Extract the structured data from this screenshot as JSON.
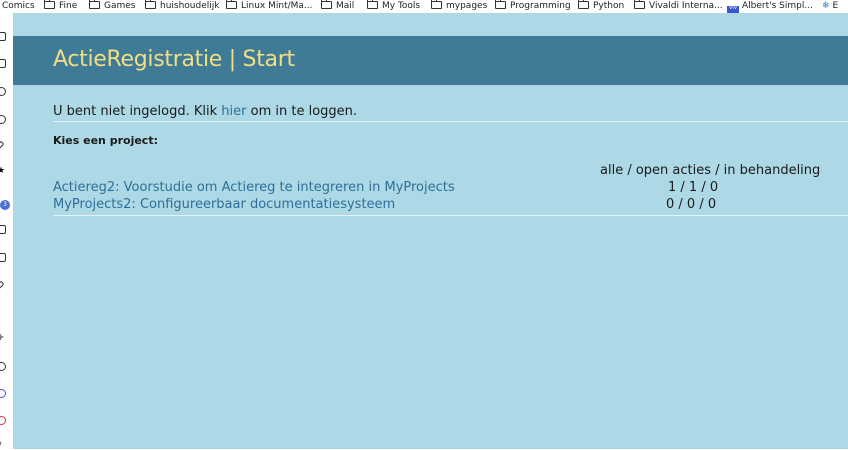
{
  "bookmarks": [
    {
      "label": "Comics",
      "icon": "none"
    },
    {
      "label": "Fine",
      "icon": "folder-icon"
    },
    {
      "label": "Games",
      "icon": "folder-icon"
    },
    {
      "label": "huishoudelijk",
      "icon": "folder-icon"
    },
    {
      "label": "Linux Mint/Ma...",
      "icon": "folder-icon"
    },
    {
      "label": "Mail",
      "icon": "folder-icon"
    },
    {
      "label": "My Tools",
      "icon": "folder-icon"
    },
    {
      "label": "mypages",
      "icon": "folder-icon"
    },
    {
      "label": "Programming",
      "icon": "folder-icon"
    },
    {
      "label": "Python",
      "icon": "folder-icon"
    },
    {
      "label": "Vivaldi Interna...",
      "icon": "folder-icon"
    },
    {
      "label": "Albert's Simpl...",
      "icon": "vivaldi-logo-icon"
    },
    {
      "label": "E",
      "icon": "snowflake-icon"
    }
  ],
  "sidepanel": {
    "badge": "3"
  },
  "page": {
    "title": "ActieRegistratie | Start",
    "login_prefix": "U bent niet ingelogd. Klik ",
    "login_link": "hier",
    "login_suffix": " om in te loggen.",
    "choose_label": "Kies een project:",
    "column_header": "alle / open acties / in behandeling",
    "projects": [
      {
        "name": "Actiereg2: Voorstudie om Actiereg te integreren in MyProjects",
        "counts": "1 / 1 / 0"
      },
      {
        "name": "MyProjects2: Configureerbaar documentatiesysteem",
        "counts": "0 / 0 / 0"
      }
    ]
  },
  "colors": {
    "header_bg": "#3f7b96",
    "title_color": "#f2de83",
    "page_bg": "#add8e6",
    "link_color": "#2e6f99"
  }
}
